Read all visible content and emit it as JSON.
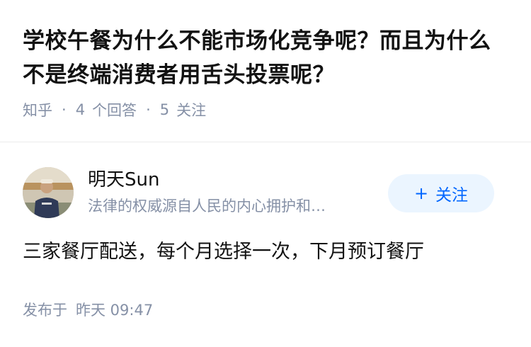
{
  "question": {
    "title": "学校午餐为什么不能市场化竞争呢？而且为什么不是终端消费者用舌头投票呢？",
    "source": "知乎",
    "answer_count": "4",
    "answer_label": "个回答",
    "follower_count": "5",
    "follower_label": "关注"
  },
  "answer": {
    "author": {
      "name": "明天Sun",
      "bio": "法律的权威源自人民的内心拥护和…",
      "avatar_icon": "person-avatar"
    },
    "follow_button": {
      "icon": "+",
      "label": "关注"
    },
    "content": "三家餐厅配送，每个月选择一次，下月预订餐厅",
    "published": {
      "label": "发布于",
      "time": "昨天 09:47"
    }
  },
  "colors": {
    "text_primary": "#121212",
    "text_secondary": "#8590a6",
    "accent": "#0066ff",
    "button_bg": "#ebf5ff",
    "divider": "#ebebeb"
  }
}
